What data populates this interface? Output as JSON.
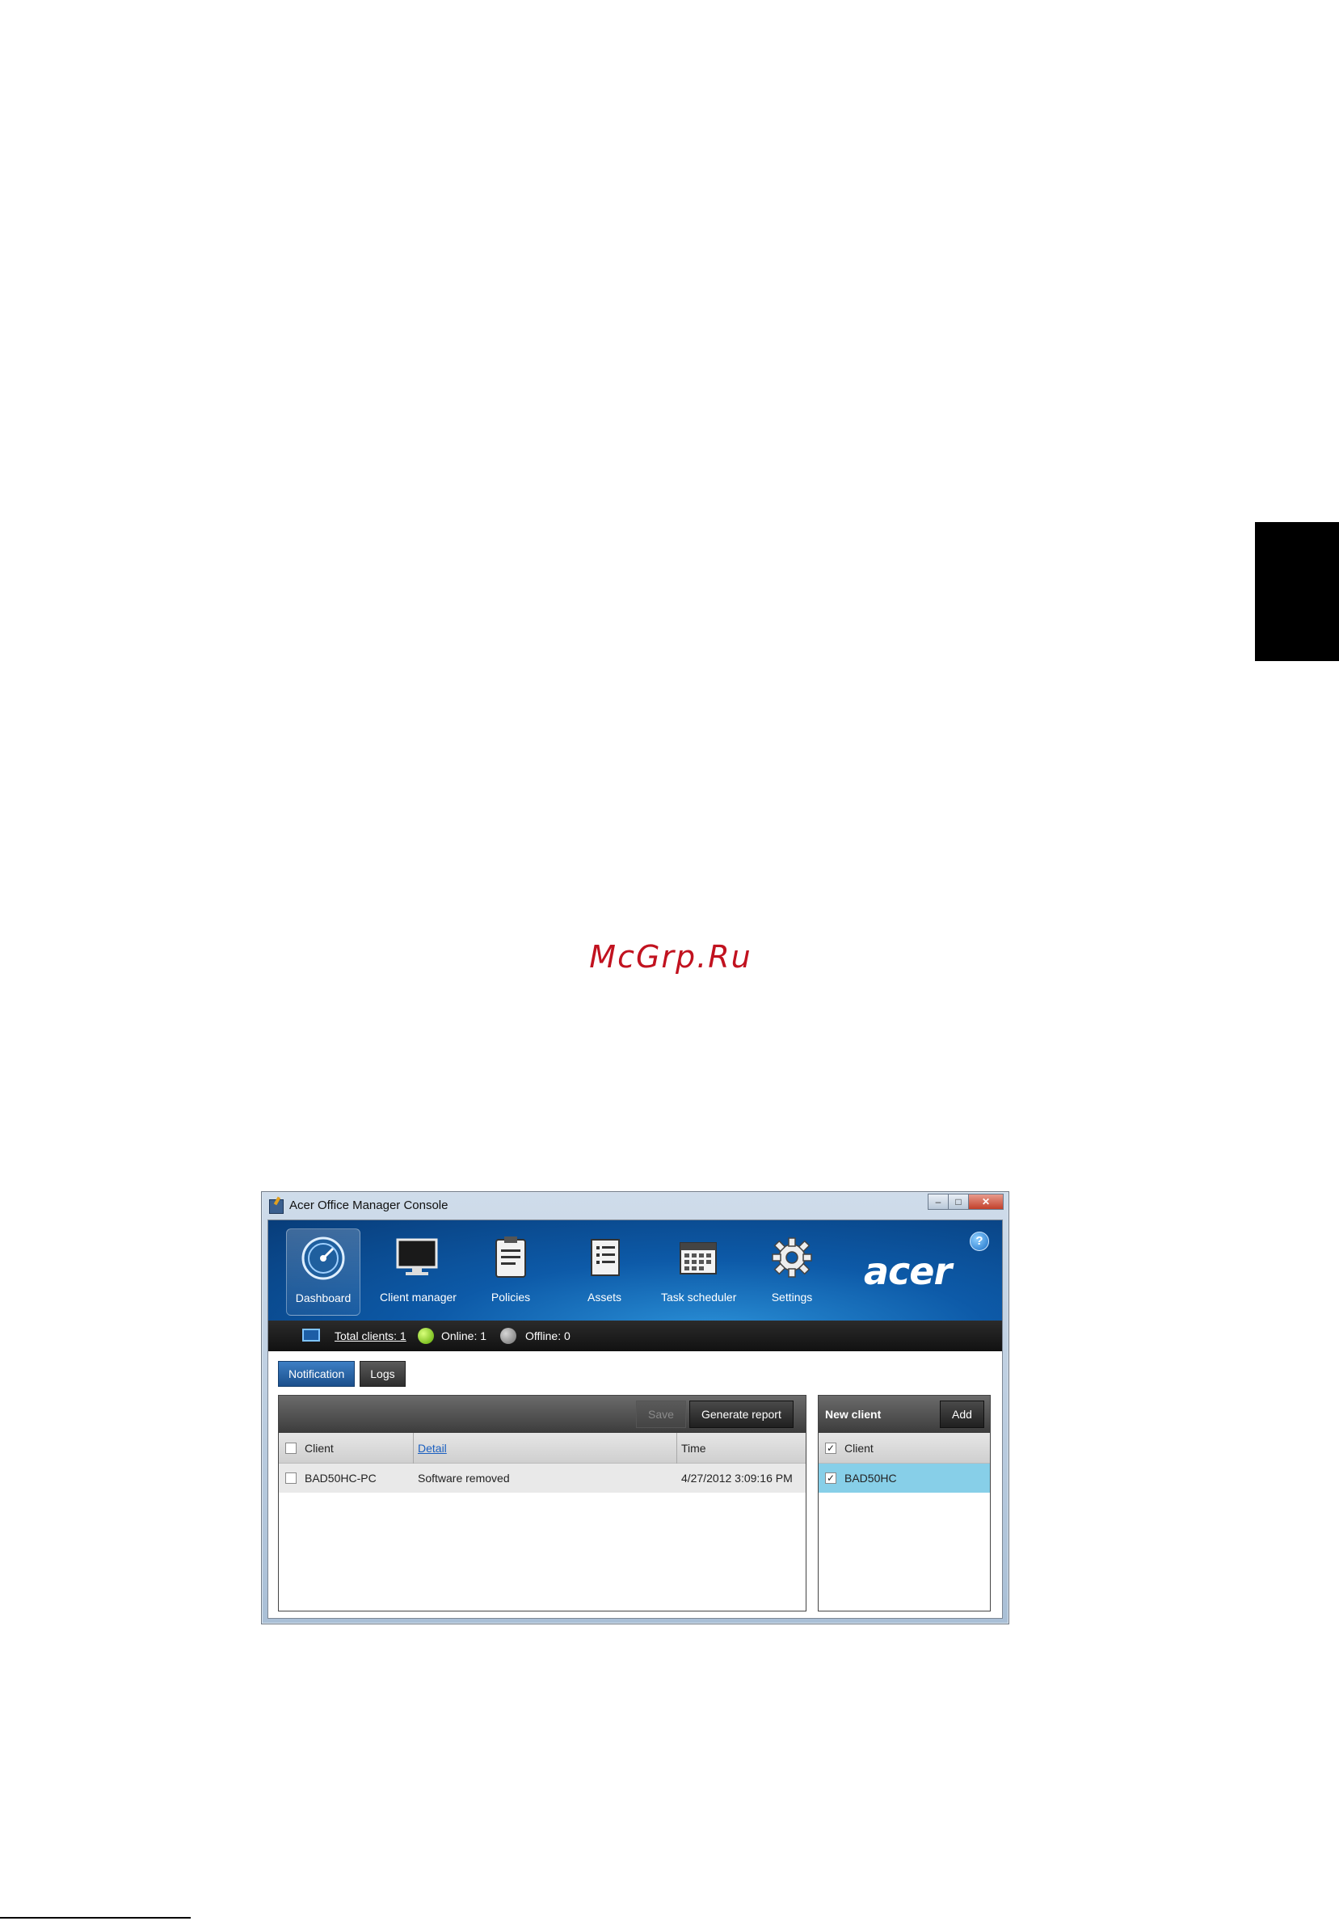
{
  "window": {
    "title": "Acer Office Manager Console",
    "controls": {
      "minimize": "‒",
      "maximize": "□",
      "close": "✕"
    }
  },
  "nav": {
    "items": [
      {
        "label": "Dashboard",
        "icon": "dashboard-icon",
        "active": true
      },
      {
        "label": "Client manager",
        "icon": "monitor-icon"
      },
      {
        "label": "Policies",
        "icon": "clipboard-icon"
      },
      {
        "label": "Assets",
        "icon": "document-list-icon"
      },
      {
        "label": "Task scheduler",
        "icon": "calendar-icon"
      },
      {
        "label": "Settings",
        "icon": "gear-icon"
      }
    ],
    "logo": "acer",
    "help": "?"
  },
  "status": {
    "total_clients": "Total clients: 1",
    "online": "Online: 1",
    "offline": "Offline: 0"
  },
  "tabs": [
    {
      "label": "Notification",
      "active": true
    },
    {
      "label": "Logs"
    }
  ],
  "notification_panel": {
    "save_label": "Save",
    "report_label": "Generate report",
    "columns": [
      "Client",
      "Detail",
      "Time"
    ],
    "rows": [
      {
        "client": "BAD50HC-PC",
        "detail": "Software removed",
        "time": "4/27/2012 3:09:16 PM"
      }
    ]
  },
  "new_client_panel": {
    "title": "New client",
    "add_label": "Add",
    "column": "Client",
    "rows": [
      {
        "client": "BAD50HC",
        "checked": true
      }
    ]
  },
  "page": {
    "watermark": "McGrp.Ru"
  },
  "colors": {
    "nav_blue": "#0d5aa8",
    "selected_row": "#87cfe8",
    "online": "#5aa800",
    "offline": "#6d6d6d",
    "watermark": "#c1121f"
  }
}
